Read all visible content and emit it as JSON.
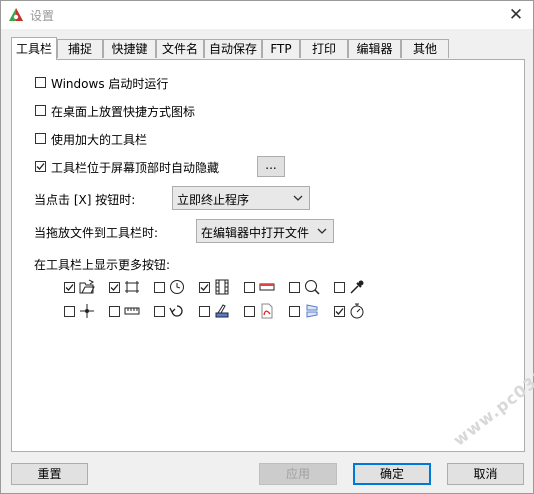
{
  "window": {
    "title": "设置",
    "close_label": "✕"
  },
  "tabs": [
    "工具栏",
    "捕捉",
    "快捷键",
    "文件名",
    "自动保存",
    "FTP",
    "打印",
    "编辑器",
    "其他"
  ],
  "options": {
    "start_with_windows": {
      "label": "Windows 启动时运行",
      "checked": false
    },
    "desktop_shortcut": {
      "label": "在桌面上放置快捷方式图标",
      "checked": false
    },
    "large_toolbar": {
      "label": "使用加大的工具栏",
      "checked": false
    },
    "autohide": {
      "label": "工具栏位于屏幕顶部时自动隐藏",
      "checked": true,
      "more_label": "..."
    }
  },
  "x_click": {
    "label": "当点击 [X] 按钮时:",
    "value": "立即终止程序"
  },
  "drop_file": {
    "label": "当拖放文件到工具栏时:",
    "value": "在编辑器中打开文件"
  },
  "more_buttons": {
    "label": "在工具栏上显示更多按钮:",
    "row1": [
      {
        "icon": "open-folder-icon",
        "checked": true
      },
      {
        "icon": "rectangle-capture-icon",
        "checked": true
      },
      {
        "icon": "timer-clock-icon",
        "checked": false
      },
      {
        "icon": "film-strip-icon",
        "checked": true
      },
      {
        "icon": "scrolling-window-icon",
        "checked": false
      },
      {
        "icon": "magnifier-icon",
        "checked": false
      },
      {
        "icon": "color-picker-icon",
        "checked": false
      }
    ],
    "row2": [
      {
        "icon": "crosshair-icon",
        "checked": false
      },
      {
        "icon": "ruler-icon",
        "checked": false
      },
      {
        "icon": "undo-arrow-icon",
        "checked": false
      },
      {
        "icon": "scanner-icon",
        "checked": false
      },
      {
        "icon": "pdf-icon",
        "checked": false
      },
      {
        "icon": "compare-panes-icon",
        "checked": false
      },
      {
        "icon": "stopwatch-icon",
        "checked": true
      }
    ]
  },
  "buttons": {
    "reset": "重置",
    "apply": "应用",
    "ok": "确定",
    "cancel": "取消"
  },
  "watermark": "www.pc0359.cn"
}
